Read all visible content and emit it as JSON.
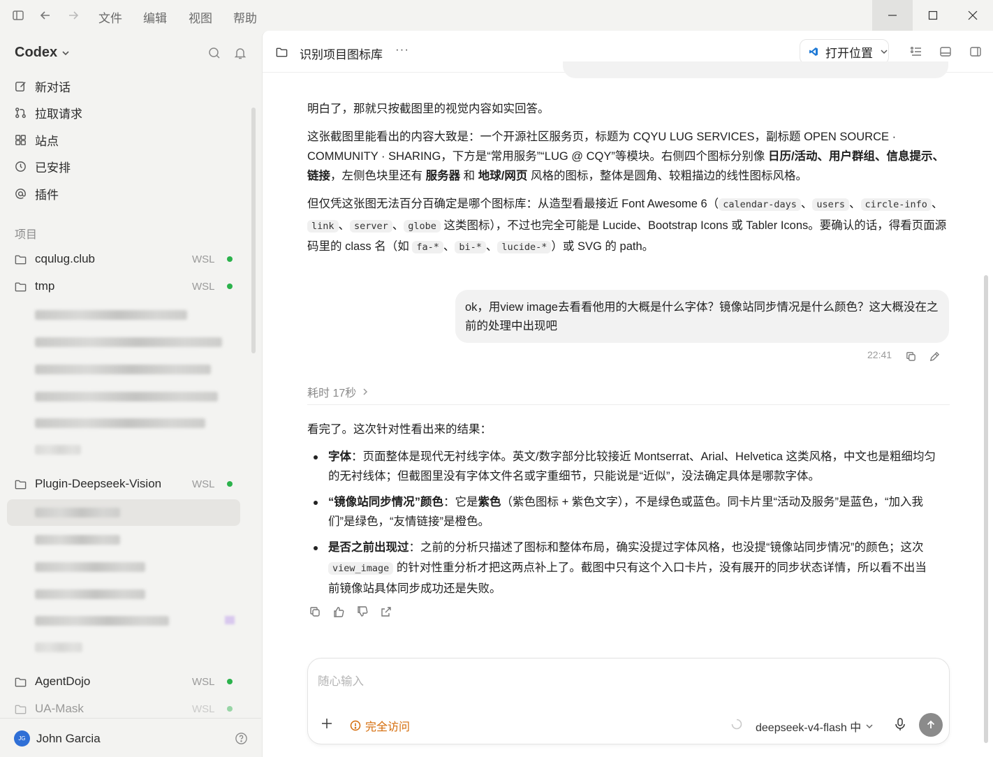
{
  "menu": [
    "文件",
    "编辑",
    "视图",
    "帮助"
  ],
  "sidebar": {
    "brand": "Codex",
    "nav": [
      {
        "label": "新对话",
        "icon": "edit-icon"
      },
      {
        "label": "拉取请求",
        "icon": "pull-request-icon"
      },
      {
        "label": "站点",
        "icon": "sites-icon"
      },
      {
        "label": "已安排",
        "icon": "clock-icon"
      },
      {
        "label": "插件",
        "icon": "at-icon"
      }
    ],
    "section_label": "项目",
    "projects": [
      {
        "name": "cqulug.club",
        "tag": "WSL"
      },
      {
        "name": "tmp",
        "tag": "WSL"
      },
      {
        "name": "Plugin-Deepseek-Vision",
        "tag": "WSL"
      },
      {
        "name": "AgentDojo",
        "tag": "WSL"
      },
      {
        "name": "UA-Mask",
        "tag": "WSL"
      }
    ],
    "user": {
      "initials": "JG",
      "name": "John Garcia"
    }
  },
  "topbar": {
    "title": "识别项目图标库",
    "more": "···",
    "open_location": "打开位置"
  },
  "conversation": {
    "p1": "明白了，那就只按截图里的视觉内容如实回答。",
    "p2": {
      "a": "这张截图里能看出的内容大致是：一个开源社区服务页，标题为 CQYU LUG SERVICES，副标题 OPEN SOURCE · COMMUNITY · SHARING，下方是“常用服务”“LUG @ CQY”等模块。右侧四个图标分别像 ",
      "b": "日历/活动、用户群组、信息提示、链接",
      "c": "，左侧色块里还有 ",
      "d": "服务器",
      "e": " 和 ",
      "f": "地球/网页",
      "g": " 风格的图标，整体是圆角、较粗描边的线性图标风格。"
    },
    "p3": {
      "a": "但仅凭这张图无法百分百确定是哪个图标库：从造型看最接近 Font Awesome 6（",
      "codes": [
        "calendar-days",
        "users",
        "circle-info",
        "link",
        "server",
        "globe"
      ],
      "b": " 这类图标），不过也完全可能是 Lucide、Bootstrap Icons 或 Tabler Icons。要确认的话，得看页面源码里的 class 名（如 ",
      "codes2": [
        "fa-*",
        "bi-*",
        "lucide-*"
      ],
      "c": "）或 SVG 的 path。"
    },
    "user_msg": "ok，用view image去看看他用的大概是什么字体？镜像站同步情况是什么颜色？这大概没在之前的处理中出现吧",
    "user_time": "22:41",
    "elapsed": "耗时 17秒",
    "result_intro": "看完了。这次针对性看出来的结果：",
    "bullets": [
      {
        "head": "字体",
        "body": "：页面整体是现代无衬线字体。英文/数字部分比较接近 Montserrat、Arial、Helvetica 这类风格，中文也是粗细均匀的无衬线体；但截图里没有字体文件名或字重细节，只能说是“近似”，没法确定具体是哪款字体。"
      },
      {
        "head": "“镜像站同步情况”颜色",
        "body_a": "：它是",
        "em": "紫色",
        "body_b": "（紫色图标 + 紫色文字），不是绿色或蓝色。同卡片里“活动及服务”是蓝色，“加入我们”是绿色，“友情链接”是橙色。"
      },
      {
        "head": "是否之前出现过",
        "body_a": "：之前的分析只描述了图标和整体布局，确实没提过字体风格，也没提“镜像站同步情况”的颜色；这次 ",
        "code": "view_image",
        "body_b": " 的针对性重分析才把这两点补上了。截图中只有这个入口卡片，没有展开的同步状态详情，所以看不出当前镜像站具体同步成功还是失败。"
      }
    ]
  },
  "composer": {
    "placeholder": "随心输入",
    "access": "完全访问",
    "model": "deepseek-v4-flash 中"
  },
  "colors": {
    "accent_green": "#2bb24c",
    "warn_orange": "#d46b08",
    "avatar_blue": "#2f6fd6"
  }
}
